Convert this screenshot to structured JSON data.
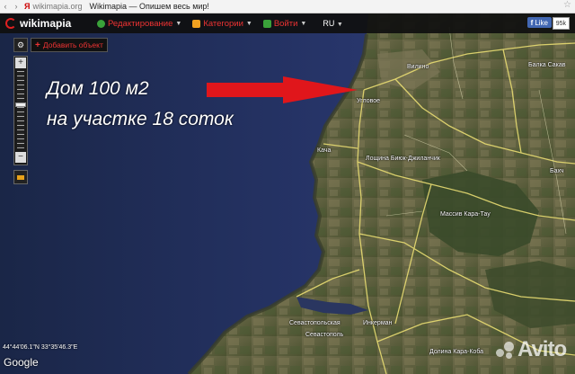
{
  "browser": {
    "yandex_label": "Я",
    "url": "wikimapia.org",
    "title": "Wikimapia — Опишем весь мир!",
    "star_icon": "star-icon"
  },
  "toolbar": {
    "logo": "wikimapia",
    "menu": [
      {
        "label": "Редактирование",
        "icon": "edit-icon",
        "color": "#3aa23a"
      },
      {
        "label": "Категории",
        "icon": "categories-icon",
        "color": "#f0a020"
      },
      {
        "label": "Войти",
        "icon": "login-icon",
        "color": "#3aa23a"
      }
    ],
    "lang": "RU",
    "fb_like": "Like",
    "fb_count": "95k"
  },
  "controls": {
    "settings_icon": "⚙",
    "add_object": "Добавить объект",
    "zoom_in": "+",
    "zoom_out": "−"
  },
  "caption": {
    "line1": "Дом 100 м2",
    "line2": "на участке 18 соток"
  },
  "places": {
    "vilino": "Вилино",
    "balka_sakav": "Балка Сакав",
    "uglovoe": "Угловое",
    "kacha": "Кача",
    "poshchina": "Лощина Биюк-Джиланчик",
    "bakhch": "Бахч",
    "massiv": "Массив Кара-Тау",
    "sevastopolskaya": "Севастопольская",
    "sevastopol": "Севастополь",
    "inkerman": "Инкерман",
    "dolina": "Долина Кара-Коба"
  },
  "map": {
    "coordinates": "44°44'06.1\"N 33°35'46.3\"E",
    "attribution": "Google",
    "watermark": "Avito"
  },
  "colors": {
    "arrow": "#e0161b",
    "sea": "#26335c",
    "menu_text": "#e33333"
  }
}
